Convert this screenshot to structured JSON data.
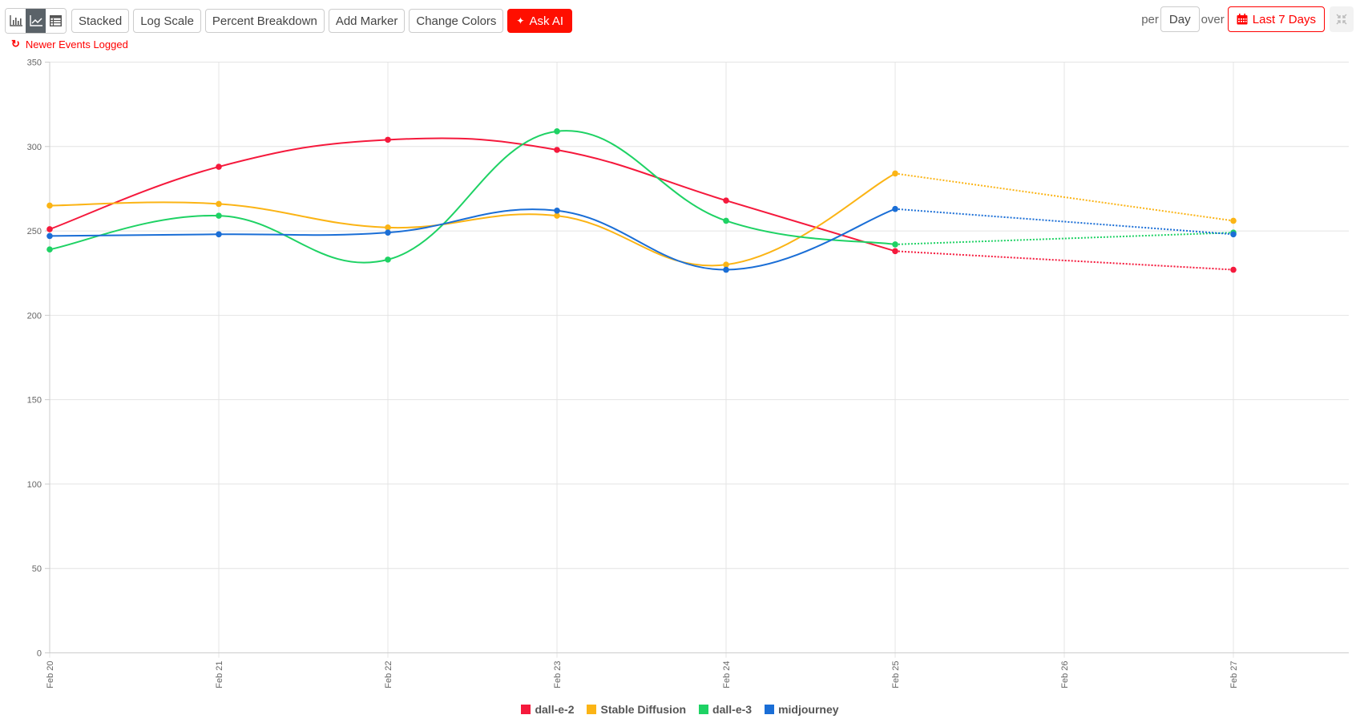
{
  "toolbar": {
    "view_buttons": [
      {
        "name": "bar-chart",
        "active": false
      },
      {
        "name": "line-chart",
        "active": true
      },
      {
        "name": "table",
        "active": false
      }
    ],
    "buttons": [
      "Stacked",
      "Log Scale",
      "Percent Breakdown",
      "Add Marker",
      "Change Colors"
    ],
    "ask_ai": "Ask AI"
  },
  "notice": "Newer Events Logged",
  "controls": {
    "per_label": "per",
    "interval": "Day",
    "over_label": "over",
    "range": "Last 7 Days"
  },
  "colors": {
    "accent": "#ff0f00",
    "dall-e-2": "#f5193c",
    "Stable Diffusion": "#fbb415",
    "dall-e-3": "#1ed264",
    "midjourney": "#1a6ed6"
  },
  "chart_data": {
    "type": "line",
    "title": "",
    "xlabel": "",
    "ylabel": "",
    "x": [
      "Feb 20",
      "Feb 21",
      "Feb 22",
      "Feb 23",
      "Feb 24",
      "Feb 25",
      "Feb 26",
      "Feb 27"
    ],
    "ylim": [
      0,
      350
    ],
    "yticks": [
      0,
      50,
      100,
      150,
      200,
      250,
      300,
      350
    ],
    "grid": true,
    "legend_position": "bottom-center",
    "partial_from_index": 5,
    "series": [
      {
        "name": "dall-e-2",
        "color": "#f5193c",
        "values": [
          251,
          288,
          304,
          298,
          268,
          238,
          null,
          227
        ]
      },
      {
        "name": "Stable Diffusion",
        "color": "#fbb415",
        "values": [
          265,
          266,
          252,
          259,
          230,
          284,
          null,
          256
        ]
      },
      {
        "name": "dall-e-3",
        "color": "#1ed264",
        "values": [
          239,
          259,
          233,
          309,
          256,
          242,
          null,
          249
        ]
      },
      {
        "name": "midjourney",
        "color": "#1a6ed6",
        "values": [
          247,
          248,
          249,
          262,
          227,
          263,
          null,
          248
        ]
      }
    ]
  }
}
